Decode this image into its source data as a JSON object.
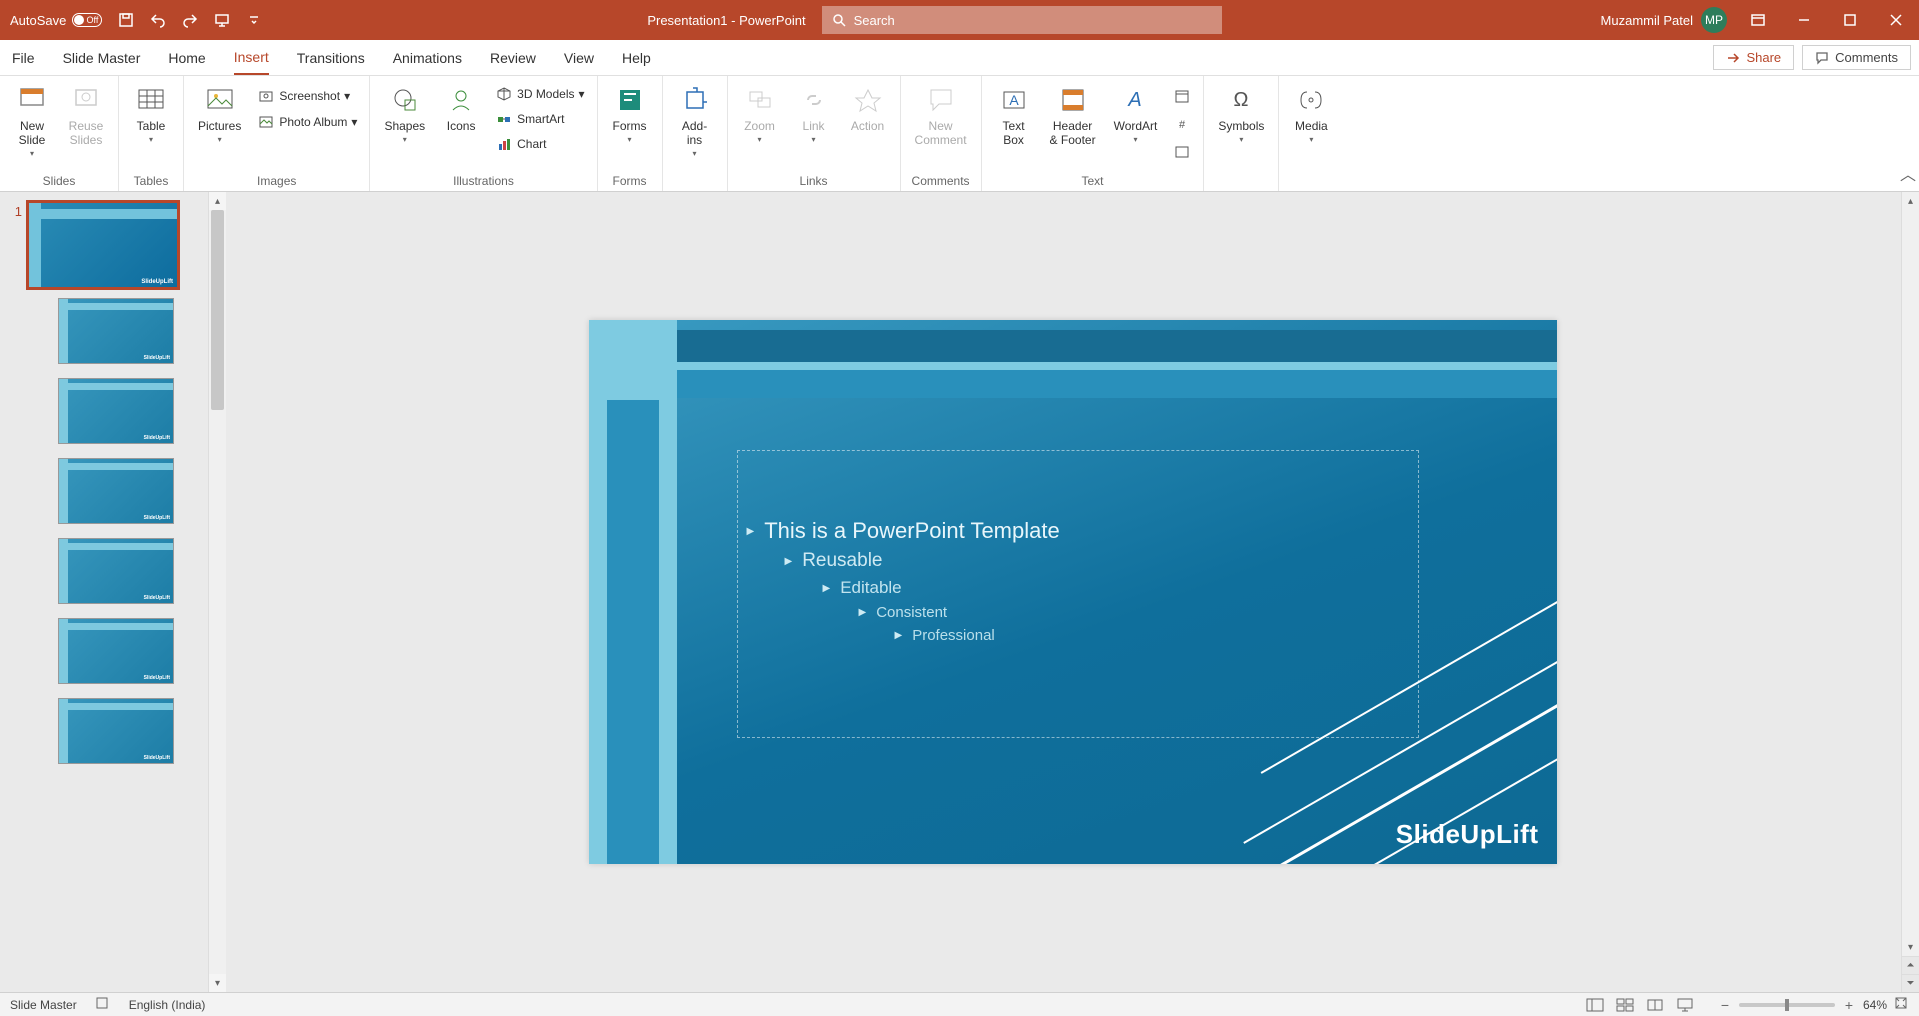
{
  "titlebar": {
    "autosave_label": "AutoSave",
    "autosave_state": "Off",
    "title": "Presentation1 - PowerPoint",
    "search_placeholder": "Search",
    "user_name": "Muzammil Patel",
    "user_initials": "MP"
  },
  "tabs": {
    "file": "File",
    "slide_master": "Slide Master",
    "home": "Home",
    "insert": "Insert",
    "transitions": "Transitions",
    "animations": "Animations",
    "review": "Review",
    "view": "View",
    "help": "Help",
    "share": "Share",
    "comments": "Comments"
  },
  "ribbon": {
    "slides": {
      "new_slide": "New\nSlide",
      "reuse_slides": "Reuse\nSlides",
      "group": "Slides"
    },
    "tables": {
      "table": "Table",
      "group": "Tables"
    },
    "images": {
      "pictures": "Pictures",
      "screenshot": "Screenshot",
      "photo_album": "Photo Album",
      "group": "Images"
    },
    "illustrations": {
      "shapes": "Shapes",
      "icons": "Icons",
      "models3d": "3D Models",
      "smartart": "SmartArt",
      "chart": "Chart",
      "group": "Illustrations"
    },
    "forms": {
      "forms": "Forms",
      "group": "Forms"
    },
    "addins": {
      "addins": "Add-\nins",
      "group": ""
    },
    "links": {
      "zoom": "Zoom",
      "link": "Link",
      "action": "Action",
      "group": "Links"
    },
    "comments": {
      "new_comment": "New\nComment",
      "group": "Comments"
    },
    "text": {
      "text_box": "Text\nBox",
      "header_footer": "Header\n& Footer",
      "wordart": "WordArt",
      "group": "Text"
    },
    "symbols": {
      "symbols": "Symbols",
      "group": ""
    },
    "media": {
      "media": "Media",
      "group": ""
    }
  },
  "thumbnails": {
    "num1": "1",
    "logo": "SlideUpLift"
  },
  "slide": {
    "lvl1": "This is a PowerPoint Template",
    "lvl2": "Reusable",
    "lvl3": "Editable",
    "lvl4": "Consistent",
    "lvl5": "Professional",
    "logo": "SlideUpLift"
  },
  "status": {
    "mode": "Slide Master",
    "language": "English (India)",
    "zoom_pct": "64%"
  }
}
